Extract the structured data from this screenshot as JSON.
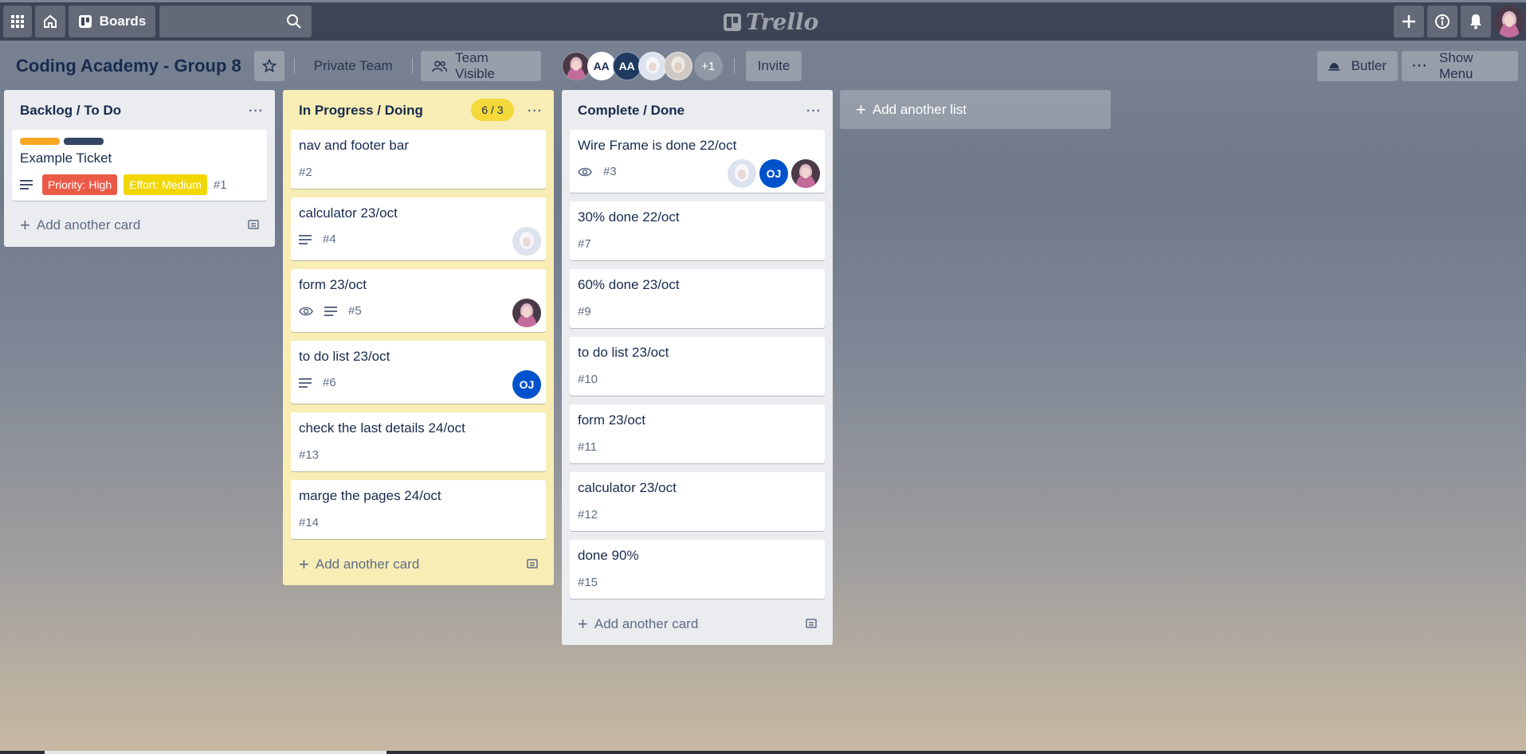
{
  "topbar": {
    "boards_label": "Boards",
    "logo_text": "Trello"
  },
  "header": {
    "board_title": "Coding Academy - Group 8",
    "private_team": "Private Team",
    "team_visible": "Team Visible",
    "members": [
      {
        "kind": "photo",
        "color": "#d36fa3"
      },
      {
        "kind": "initials",
        "initials": "AA",
        "color": "#ffffff",
        "text": "#172b4d"
      },
      {
        "kind": "initials",
        "initials": "AA",
        "color": "#1e3a5f",
        "text": "#ffffff"
      },
      {
        "kind": "photo",
        "color": "#c9cfe0"
      },
      {
        "kind": "photo",
        "color": "#d0c8bf"
      }
    ],
    "extra_members": "+1",
    "invite": "Invite",
    "butler": "Butler",
    "show_menu": "Show Menu"
  },
  "lists": {
    "backlog": {
      "title": "Backlog / To Do",
      "add_card": "Add another card",
      "cards": [
        {
          "title": "Example Ticket",
          "labels_colors": [
            "#f5a623",
            "#344563"
          ],
          "priority": "Priority: High",
          "effort": "Effort: Medium",
          "number": "#1"
        }
      ]
    },
    "doing": {
      "title": "In Progress / Doing",
      "wip": "6 / 3",
      "add_card": "Add another card",
      "cards": [
        {
          "title": "nav and footer bar",
          "number": "#2"
        },
        {
          "title": "calculator 23/oct",
          "number": "#4"
        },
        {
          "title": "form 23/oct",
          "number": "#5"
        },
        {
          "title": "to do list 23/oct",
          "number": "#6",
          "avatar_initials": "OJ"
        },
        {
          "title": "check the last details 24/oct",
          "number": "#13"
        },
        {
          "title": "marge the pages 24/oct",
          "number": "#14"
        }
      ]
    },
    "done": {
      "title": "Complete / Done",
      "add_card": "Add another card",
      "cards": [
        {
          "title": "Wire Frame is done 22/oct",
          "number": "#3",
          "avatar_initials": "OJ"
        },
        {
          "title": "30% done 22/oct",
          "number": "#7"
        },
        {
          "title": "60% done 23/oct",
          "number": "#9"
        },
        {
          "title": "to do list 23/oct",
          "number": "#10"
        },
        {
          "title": "form 23/oct",
          "number": "#11"
        },
        {
          "title": "calculator 23/oct",
          "number": "#12"
        },
        {
          "title": "done 90%",
          "number": "#15"
        }
      ]
    }
  },
  "add_list": "Add another list",
  "colors": {
    "topbar": "#3c4455",
    "priority_high": "#eb5a46",
    "effort_medium": "#f2d600",
    "wip_badge": "#f5d83a",
    "doing_list": "#f8edb5",
    "oj_avatar": "#0052cc"
  }
}
